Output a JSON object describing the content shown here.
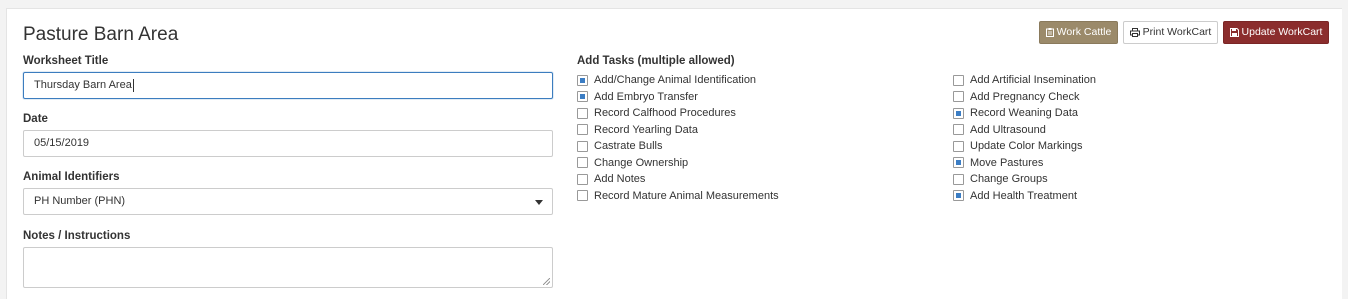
{
  "page": {
    "title": "Pasture Barn Area"
  },
  "toolbar": {
    "work_cattle_label": "Work Cattle",
    "print_label": "Print WorkCart",
    "update_label": "Update WorkCart"
  },
  "form": {
    "worksheet_title_label": "Worksheet Title",
    "worksheet_title_value": "Thursday Barn Area",
    "date_label": "Date",
    "date_value": "05/15/2019",
    "identifiers_label": "Animal Identifiers",
    "identifiers_value": "PH Number (PHN)",
    "notes_label": "Notes / Instructions",
    "notes_value": ""
  },
  "tasks": {
    "label": "Add Tasks (multiple allowed)",
    "left": [
      {
        "label": "Add/Change Animal Identification",
        "checked": true
      },
      {
        "label": "Add Embryo Transfer",
        "checked": true
      },
      {
        "label": "Record Calfhood Procedures",
        "checked": false
      },
      {
        "label": "Record Yearling Data",
        "checked": false
      },
      {
        "label": "Castrate Bulls",
        "checked": false
      },
      {
        "label": "Change Ownership",
        "checked": false
      },
      {
        "label": "Add Notes",
        "checked": false
      },
      {
        "label": "Record Mature Animal Measurements",
        "checked": false
      }
    ],
    "right": [
      {
        "label": "Add Artificial Insemination",
        "checked": false
      },
      {
        "label": "Add Pregnancy Check",
        "checked": false
      },
      {
        "label": "Record Weaning Data",
        "checked": true
      },
      {
        "label": "Add Ultrasound",
        "checked": false
      },
      {
        "label": "Update Color Markings",
        "checked": false
      },
      {
        "label": "Move Pastures",
        "checked": true
      },
      {
        "label": "Change Groups",
        "checked": false
      },
      {
        "label": "Add Health Treatment",
        "checked": true
      }
    ]
  },
  "colors": {
    "work_cattle_button": "#9b8a6a",
    "update_button": "#8b2d2d",
    "checkbox_fill": "#3b7dc4",
    "focus_border": "#3c7dbf"
  }
}
